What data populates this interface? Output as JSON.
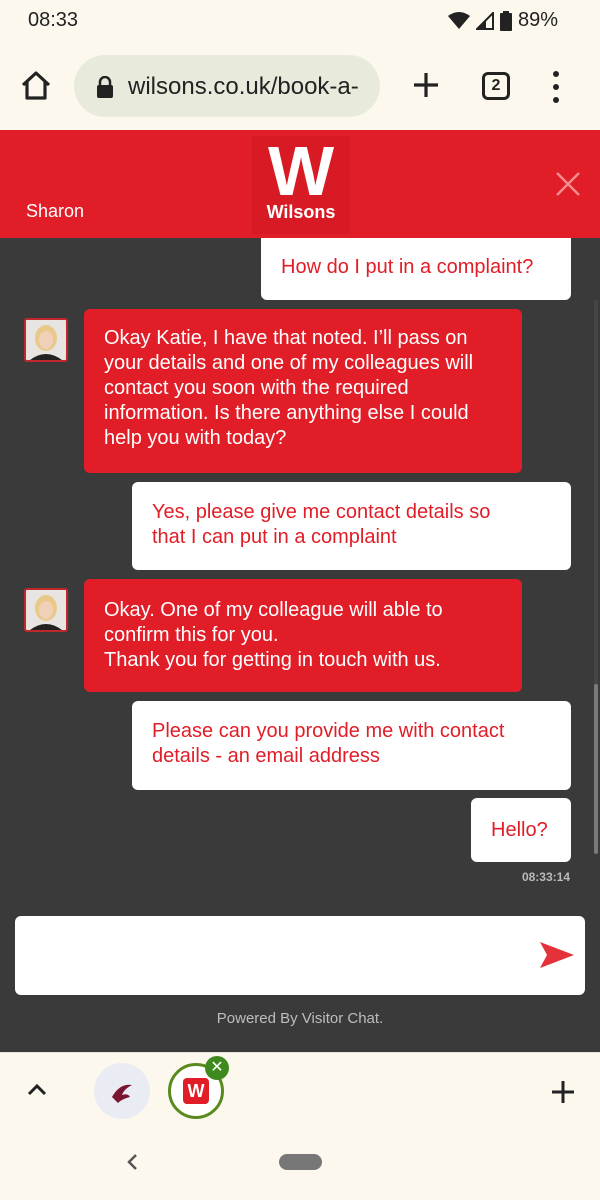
{
  "status": {
    "time": "08:33",
    "battery": "89%"
  },
  "browser": {
    "url": "wilsons.co.uk/book-a-",
    "tab_count": "2"
  },
  "chat_header": {
    "agent_name": "Sharon",
    "logo_letter": "W",
    "logo_text": "Wilsons"
  },
  "messages": [
    {
      "from": "user",
      "text": "How do I put in a complaint?"
    },
    {
      "from": "agent",
      "lines": [
        "Okay Katie, I have that noted. I’ll pass on",
        "your details and one of my colleagues will",
        "contact you soon with the required",
        "information. Is there anything else I could",
        "help you with today?"
      ]
    },
    {
      "from": "user",
      "lines": [
        "Yes, please give me contact details so",
        "that I can put in a complaint"
      ]
    },
    {
      "from": "agent",
      "lines": [
        "Okay. One of my colleague will able to",
        "confirm this for you.",
        "Thank you for getting in touch with us."
      ]
    },
    {
      "from": "user",
      "lines": [
        "Please can you provide me with contact",
        "details - an email address"
      ]
    },
    {
      "from": "user",
      "text": "Hello?"
    }
  ],
  "timestamp": "08:33:14",
  "composer": {
    "value": ""
  },
  "powered_by": "Powered By Visitor Chat.",
  "bubble_badge_letter": "W",
  "colors": {
    "brand_red": "#e11d27",
    "chat_bg": "#3a3a3a",
    "chrome_bg": "#fcf8ee"
  }
}
